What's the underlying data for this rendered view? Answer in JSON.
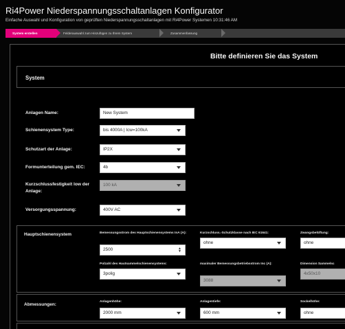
{
  "app": {
    "title": "Ri4Power Niederspannungsschaltanlagen Konfigurator",
    "subtitle": "Einfache Auswahl und Konfiguration von geprüften Niederspannungsschaltanlagen mit Ri4Power Systemen 10:31:46 AM"
  },
  "steps": [
    {
      "label": "System erstellen",
      "active": true
    },
    {
      "label": "Felderauswahl zum Hinzufügen zu Ihrem System",
      "active": false
    },
    {
      "label": "Zusammenfassung",
      "active": false
    }
  ],
  "page_heading": "Bitte definieren Sie das System",
  "system_panel": {
    "title": "System"
  },
  "fields": {
    "name": {
      "label": "Anlagen Name:",
      "value": "New System"
    },
    "schienensystem": {
      "label": "Schienensystem Type:",
      "value": "bis 4000A | Icw=100kA"
    },
    "schutzart": {
      "label": "Schutzart der Anlage:",
      "value": "IP2X"
    },
    "formunterteilung": {
      "label": "Formunterteilung gem. IEC:",
      "value": "4b"
    },
    "kurzschluss": {
      "label": "Kurzschlussfestigkeit low der Anlage:",
      "value": "100 kA"
    },
    "versorgung": {
      "label": "Versorgungsspannung:",
      "value": "400V AC"
    }
  },
  "hauptschienensystem": {
    "title": "Hauptschienensystem",
    "bemessungsstrom": {
      "label": "Bemessungsstrom des Hauptschienensystems InA (A):",
      "value": "2500"
    },
    "schutzklasse": {
      "label": "Kurzschluss.-Schutzklasse nach IEC 61641:",
      "value": "ohne"
    },
    "zwangsbeluftung": {
      "label": "Zwangsbelüftung:",
      "value": "ohne"
    },
    "polzahl": {
      "label": "Polzahl des Hautsammelschienensystems:",
      "value": "3polig"
    },
    "max_strom": {
      "label": "maximaler Bemessungsbetriebsstrom Inc (A):",
      "value": "3088"
    },
    "dimension": {
      "label": "Dimension Sammelsc",
      "value": "4x50x10"
    }
  },
  "abmessungen": {
    "title": "Abmessungen:",
    "hoehe": {
      "label": "Anlagenhöhe:",
      "value": "2000 mm"
    },
    "tiefe": {
      "label": "Anlagentiefe:",
      "value": "600 mm"
    },
    "sockel": {
      "label": "Sockelhöhe:",
      "value": "ohne"
    }
  },
  "colors": {
    "accent": "#e2007a",
    "background": "#000000"
  }
}
